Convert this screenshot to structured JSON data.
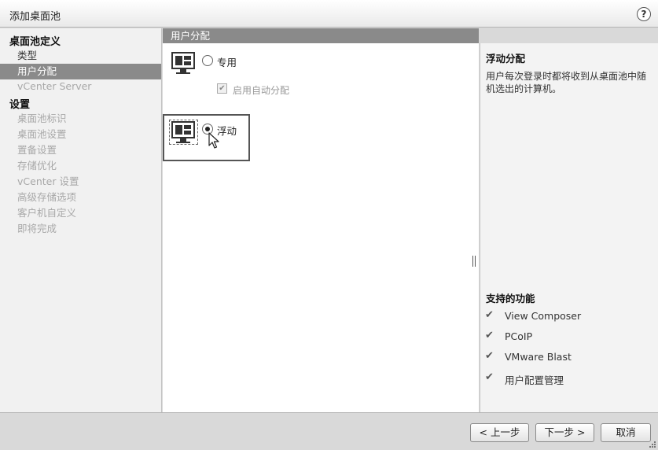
{
  "window": {
    "title": "添加桌面池",
    "help_label": "?"
  },
  "sidebar": {
    "sections": [
      {
        "title": "桌面池定义"
      },
      {
        "title": "设置"
      }
    ],
    "items": [
      {
        "label": "类型",
        "state": "normal"
      },
      {
        "label": "用户分配",
        "state": "selected"
      },
      {
        "label": "vCenter Server",
        "state": "disabled"
      },
      {
        "label": "桌面池标识",
        "state": "disabled"
      },
      {
        "label": "桌面池设置",
        "state": "disabled"
      },
      {
        "label": "置备设置",
        "state": "disabled"
      },
      {
        "label": "存储优化",
        "state": "disabled"
      },
      {
        "label": "vCenter 设置",
        "state": "disabled"
      },
      {
        "label": "高级存储选项",
        "state": "disabled"
      },
      {
        "label": "客户机自定义",
        "state": "disabled"
      },
      {
        "label": "即将完成",
        "state": "disabled"
      }
    ]
  },
  "content": {
    "header": "用户分配",
    "options": [
      {
        "label": "专用",
        "selected": false
      },
      {
        "label": "浮动",
        "selected": true
      }
    ],
    "auto_assign": {
      "label": "启用自动分配",
      "checked": true,
      "disabled": true
    }
  },
  "info_panel": {
    "title": "浮动分配",
    "description": "用户每次登录时都将收到从桌面池中随机选出的计算机。",
    "features_title": "支持的功能",
    "features": [
      "View Composer",
      "PCoIP",
      "VMware Blast",
      "用户配置管理"
    ]
  },
  "footer": {
    "back": "< 上一步",
    "next": "下一步 >",
    "cancel": "取消"
  },
  "colors": {
    "selected_bg": "#8a8a8a",
    "disabled_text": "#a8a8a8"
  }
}
